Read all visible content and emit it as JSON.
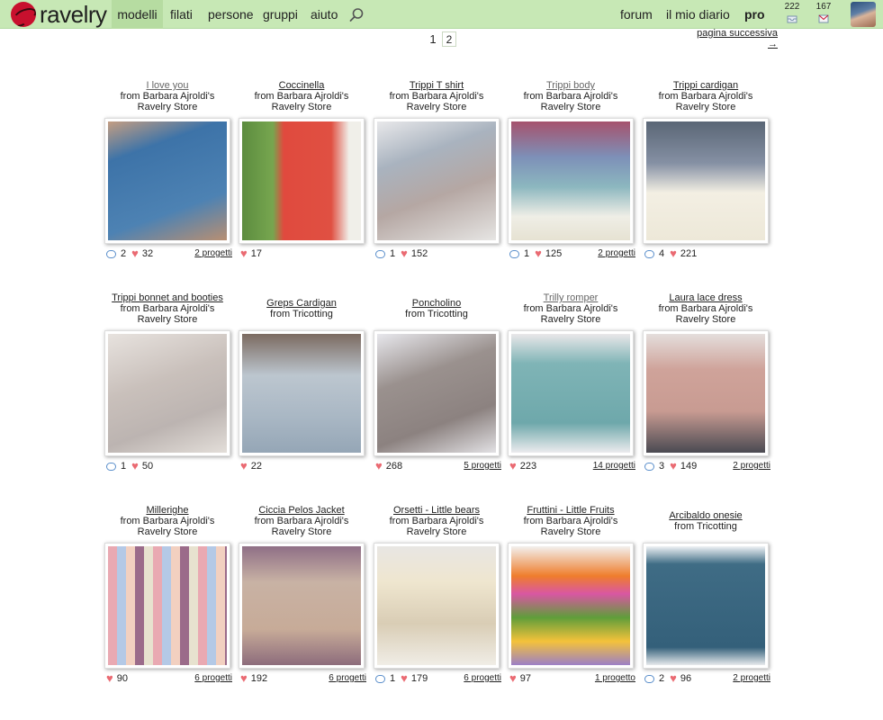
{
  "nav": {
    "logo": "ravelry",
    "links": [
      "modelli",
      "filati",
      "persone",
      "gruppi",
      "aiuto"
    ],
    "right_links": [
      "forum",
      "il mio diario",
      "pro"
    ],
    "badge_inbox": "222",
    "badge_messages": "167"
  },
  "pagination": {
    "current": "1",
    "other": "2",
    "next_label": "pagina successiva",
    "next_arrow": "→"
  },
  "cards": [
    {
      "title": "I love you",
      "src1": "from Barbara Ajroldi's",
      "src2": "Ravelry Store",
      "comments": "2",
      "hearts": "32",
      "projects": "2 progetti"
    },
    {
      "title": "Coccinella",
      "src1": "from Barbara Ajroldi's",
      "src2": "Ravelry Store",
      "comments": "",
      "hearts": "17",
      "projects": ""
    },
    {
      "title": "Trippi T shirt",
      "src1": "from Barbara Ajroldi's",
      "src2": "Ravelry Store",
      "comments": "1",
      "hearts": "152",
      "projects": ""
    },
    {
      "title": "Trippi body",
      "src1": "from Barbara Ajroldi's",
      "src2": "Ravelry Store",
      "comments": "1",
      "hearts": "125",
      "projects": "2 progetti"
    },
    {
      "title": "Trippi cardigan",
      "src1": "from Barbara Ajroldi's",
      "src2": "Ravelry Store",
      "comments": "4",
      "hearts": "221",
      "projects": ""
    },
    {
      "title": "Trippi bonnet and booties",
      "src1": "from Barbara Ajroldi's",
      "src2": "Ravelry Store",
      "comments": "1",
      "hearts": "50",
      "projects": ""
    },
    {
      "title": "Greps Cardigan",
      "src1": "from Tricotting",
      "src2": "",
      "comments": "",
      "hearts": "22",
      "projects": ""
    },
    {
      "title": "Poncholino",
      "src1": "from Tricotting",
      "src2": "",
      "comments": "",
      "hearts": "268",
      "projects": "5 progetti"
    },
    {
      "title": "Trilly romper",
      "src1": "from Barbara Ajroldi's",
      "src2": "Ravelry Store",
      "comments": "",
      "hearts": "223",
      "projects": "14 progetti"
    },
    {
      "title": "Laura lace dress",
      "src1": "from Barbara Ajroldi's",
      "src2": "Ravelry Store",
      "comments": "3",
      "hearts": "149",
      "projects": "2 progetti"
    },
    {
      "title": "Millerighe",
      "src1": "from Barbara Ajroldi's",
      "src2": "Ravelry Store",
      "comments": "",
      "hearts": "90",
      "projects": "6 progetti"
    },
    {
      "title": "Ciccia Pelos Jacket",
      "src1": "from Barbara Ajroldi's",
      "src2": "Ravelry Store",
      "comments": "",
      "hearts": "192",
      "projects": "6 progetti"
    },
    {
      "title": "Orsetti - Little bears",
      "src1": "from Barbara Ajroldi's",
      "src2": "Ravelry Store",
      "comments": "1",
      "hearts": "179",
      "projects": "6 progetti"
    },
    {
      "title": "Fruttini - Little Fruits",
      "src1": "from Barbara Ajroldi's",
      "src2": "Ravelry Store",
      "comments": "",
      "hearts": "97",
      "projects": "1 progetto"
    },
    {
      "title": "Arcibaldo onesie",
      "src1": "from Tricotting",
      "src2": "",
      "comments": "2",
      "hearts": "96",
      "projects": "2 progetti"
    }
  ],
  "colors": {
    "nav_bg": "#c7e8b5",
    "heart": "#ea6a72",
    "comment": "#5b8fcb"
  },
  "icons": [
    "ravelry-logo-icon",
    "search-icon",
    "inbox-icon",
    "messages-icon",
    "comment-icon",
    "heart-icon"
  ]
}
